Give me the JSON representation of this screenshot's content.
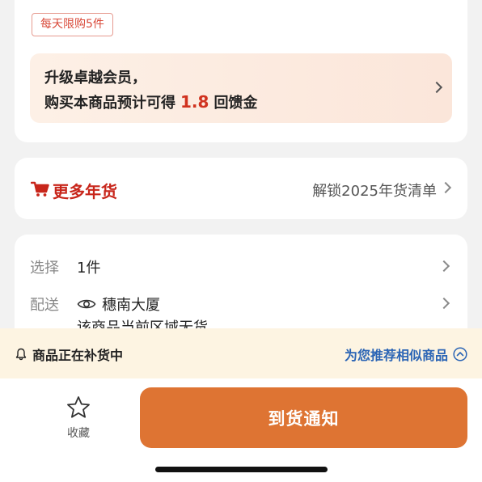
{
  "purchase_limit": {
    "label": "每天限购5件"
  },
  "member_banner": {
    "line1": "升级卓越会员，",
    "line2_prefix": "购买本商品预计可得",
    "amount": "1.8",
    "line2_suffix": "回馈金"
  },
  "nianhuo": {
    "icon": "cart-icon",
    "title": "更多年货",
    "link_text": "解锁2025年货清单"
  },
  "options": {
    "select": {
      "label": "选择",
      "value": "1件"
    },
    "shipping": {
      "label": "配送",
      "icon": "eye-icon",
      "address": "穗南大厦",
      "stock_note": "该商品当前区域无货"
    }
  },
  "restock_bar": {
    "status": "商品正在补货中",
    "recommend": "为您推荐相似商品"
  },
  "bottom_bar": {
    "favorite_label": "收藏",
    "notify_label": "到货通知"
  },
  "colors": {
    "accent": "#de7433",
    "price_red": "#d0321f",
    "link_blue": "#2a64b5",
    "notice_bg": "#fdf4e2"
  }
}
